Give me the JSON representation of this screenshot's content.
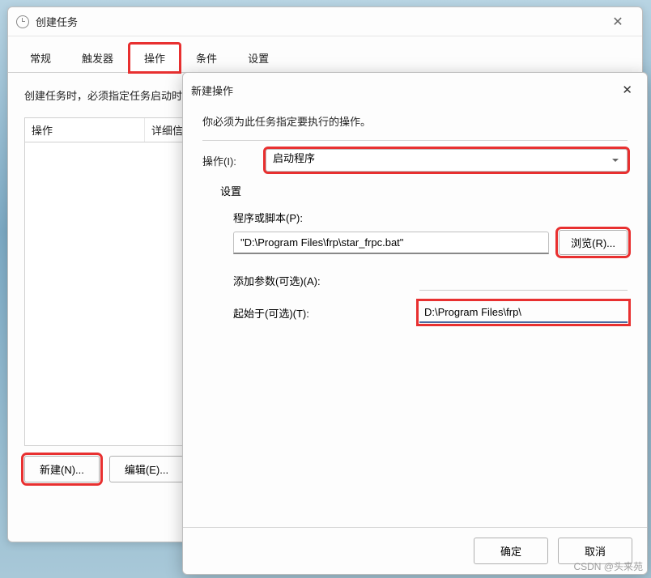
{
  "main_window": {
    "title": "创建任务",
    "close": "✕",
    "tabs": [
      "常规",
      "触发器",
      "操作",
      "条件",
      "设置"
    ],
    "instruction": "创建任务时，必须指定任务启动时将发生的操作。",
    "list_cols": [
      "操作",
      "详细信息"
    ],
    "buttons": {
      "new": "新建(N)...",
      "edit": "编辑(E)..."
    }
  },
  "modal": {
    "title": "新建操作",
    "close": "✕",
    "instruction": "你必须为此任务指定要执行的操作。",
    "action_label": "操作(I):",
    "action_value": "启动程序",
    "settings_label": "设置",
    "program_label": "程序或脚本(P):",
    "program_value": "\"D:\\Program Files\\frp\\star_frpc.bat\"",
    "browse": "浏览(R)...",
    "args_label": "添加参数(可选)(A):",
    "args_value": "",
    "startin_label": "起始于(可选)(T):",
    "startin_value": "D:\\Program Files\\frp\\",
    "ok": "确定",
    "cancel": "取消"
  },
  "watermark": "CSDN @头来苑"
}
